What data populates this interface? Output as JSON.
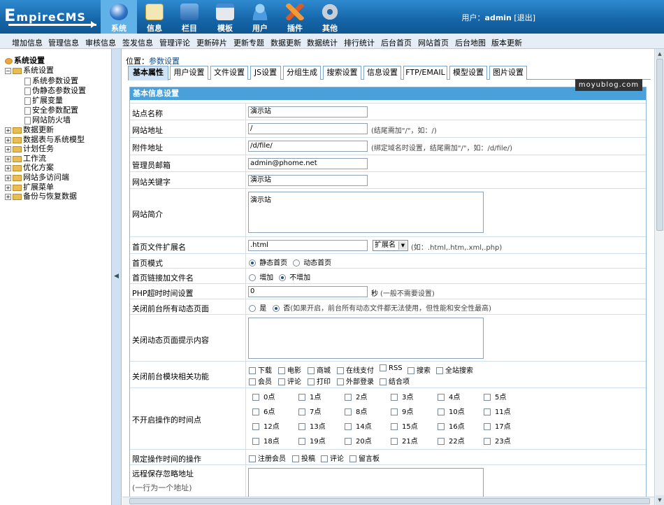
{
  "app": {
    "logo_text": "EmpireCMS",
    "logo_first": "E",
    "logo_rest": "mpireCMS",
    "user_label": "用户：",
    "user_name": "admin",
    "logout": "[退出]"
  },
  "topnav": [
    {
      "label": "系统",
      "icon": "globe-icon",
      "color": "#3d7fd6"
    },
    {
      "label": "信息",
      "icon": "notepad-icon",
      "color": "#f0e2a8"
    },
    {
      "label": "栏目",
      "icon": "folder-icon",
      "color": "#4a86c8"
    },
    {
      "label": "模板",
      "icon": "template-window-icon",
      "color": "#d9dde2"
    },
    {
      "label": "用户",
      "icon": "user-icon",
      "color": "#5aa4e0"
    },
    {
      "label": "插件",
      "icon": "tools-icon",
      "color": "#f08a2a"
    },
    {
      "label": "其他",
      "icon": "gear-icon",
      "color": "#b9c3cc"
    }
  ],
  "menubar": [
    "增加信息",
    "管理信息",
    "审核信息",
    "签发信息",
    "管理评论",
    "更新碎片",
    "更新专题",
    "数据更新",
    "数据统计",
    "排行统计",
    "后台首页",
    "网站首页",
    "后台地图",
    "版本更新"
  ],
  "tree": {
    "root": "系统设置",
    "open_node": "系统设置",
    "children": [
      "系统参数设置",
      "伪静态参数设置",
      "扩展变量",
      "安全参数配置",
      "网站防火墙"
    ],
    "nodes": [
      "数据更新",
      "数据表与系统模型",
      "计划任务",
      "工作流",
      "优化方案",
      "网站多访问端",
      "扩展菜单",
      "备份与恢复数据"
    ]
  },
  "location": {
    "label": "位置：",
    "link": "参数设置"
  },
  "tabs": [
    "基本属性",
    "用户设置",
    "文件设置",
    "JS设置",
    "分组生成",
    "搜索设置",
    "信息设置",
    "FTP/EMAIL",
    "模型设置",
    "图片设置"
  ],
  "section_title": "基本信息设置",
  "form": {
    "site_name": {
      "label": "站点名称",
      "value": "演示站"
    },
    "site_url": {
      "label": "网站地址",
      "value": "/",
      "hint": "(结尾需加\"/\"，如：/)"
    },
    "attach_url": {
      "label": "附件地址",
      "value": "/d/file/",
      "hint": "(绑定域名时设置，结尾需加\"/\"，如：/d/file/)"
    },
    "admin_email": {
      "label": "管理员邮箱",
      "value": "admin@phome.net"
    },
    "keywords": {
      "label": "网站关键字",
      "value": "演示站"
    },
    "description": {
      "label": "网站简介",
      "value": "演示站"
    },
    "index_ext": {
      "label": "首页文件扩展名",
      "value": ".html",
      "select": "扩展名",
      "hint": "(如：.html,.htm,.xml,.php)"
    },
    "index_mode": {
      "label": "首页模式",
      "options": [
        "静态首页",
        "动态首页"
      ],
      "selected": "静态首页"
    },
    "index_link_file": {
      "label": "首页链接加文件名",
      "options": [
        "增加",
        "不增加"
      ],
      "selected": "不增加"
    },
    "php_timeout": {
      "label": "PHP超时时间设置",
      "value": "0",
      "unit": "秒",
      "hint": "(一般不需要设置)"
    },
    "close_dynamic": {
      "label": "关闭前台所有动态页面",
      "options": [
        "是",
        "否"
      ],
      "selected": "否",
      "hint": "(如果开启，前台所有动态文件都无法使用，但性能和安全性最高)"
    },
    "close_dynamic_msg": {
      "label": "关闭动态页面提示内容",
      "value": ""
    },
    "close_modules": {
      "label": "关闭前台模块相关功能",
      "row1": [
        "下载",
        "电影",
        "商城",
        "在线支付",
        "RSS",
        "搜索",
        "全站搜索"
      ],
      "row2": [
        "会员",
        "评论",
        "打印",
        "外部登录",
        "结合项"
      ]
    },
    "closed_hours": {
      "label": "不开启操作的时间点",
      "hours": [
        "0点",
        "1点",
        "2点",
        "3点",
        "4点",
        "5点",
        "6点",
        "7点",
        "8点",
        "9点",
        "10点",
        "11点",
        "12点",
        "13点",
        "14点",
        "15点",
        "16点",
        "17点",
        "18点",
        "19点",
        "20点",
        "21点",
        "22点",
        "23点"
      ]
    },
    "limit_ops": {
      "label": "限定操作时间的操作",
      "options": [
        "注册会员",
        "投稿",
        "评论",
        "留言板"
      ]
    },
    "remote_ignore": {
      "label": "远程保存忽略地址",
      "sub": "(一行为一个地址)",
      "value": ""
    }
  },
  "watermark": "moyublog.com"
}
